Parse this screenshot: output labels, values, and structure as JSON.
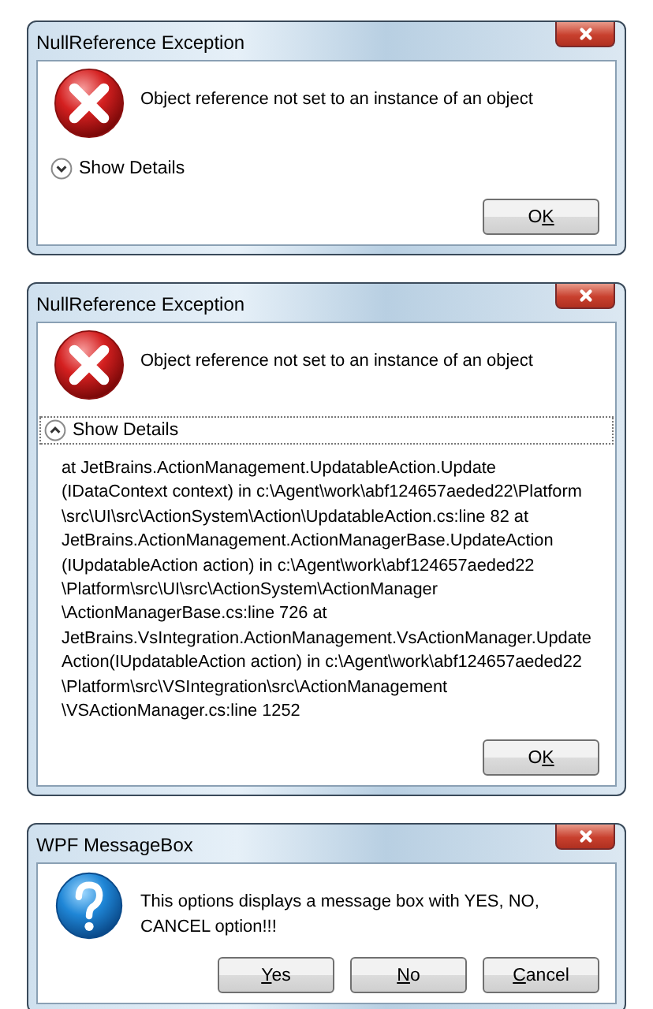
{
  "dialogs": [
    {
      "title": "NullReference Exception",
      "kind": "error",
      "message": "Object reference not set to an instance of an object",
      "details": {
        "label": "Show Details",
        "expanded": false
      },
      "buttons": [
        {
          "before": "O",
          "key": "K"
        }
      ]
    },
    {
      "title": "NullReference Exception",
      "kind": "error",
      "message": "Object reference not set to an instance of an object",
      "details": {
        "label": "Show Details",
        "expanded": true,
        "text": "at JetBrains.ActionManagement.UpdatableAction.Update (IDataContext context) in c:\\Agent\\work\\abf124657aeded22\\Platform \\src\\UI\\src\\ActionSystem\\Action\\UpdatableAction.cs:line 82 at JetBrains.ActionManagement.ActionManagerBase.UpdateAction (IUpdatableAction action) in c:\\Agent\\work\\abf124657aeded22 \\Platform\\src\\UI\\src\\ActionSystem\\ActionManager \\ActionManagerBase.cs:line 726 at JetBrains.VsIntegration.ActionManagement.VsActionManager.Update Action(IUpdatableAction action) in c:\\Agent\\work\\abf124657aeded22 \\Platform\\src\\VSIntegration\\src\\ActionManagement \\VSActionManager.cs:line 1252"
      },
      "buttons": [
        {
          "before": "O",
          "key": "K"
        }
      ]
    },
    {
      "title": "WPF MessageBox",
      "kind": "question",
      "message": "This options displays a message box with YES, NO, CANCEL option!!!",
      "buttons": [
        {
          "key": "Y",
          "after": "es"
        },
        {
          "key": "N",
          "after": "o"
        },
        {
          "key": "C",
          "after": "ancel"
        }
      ]
    }
  ]
}
